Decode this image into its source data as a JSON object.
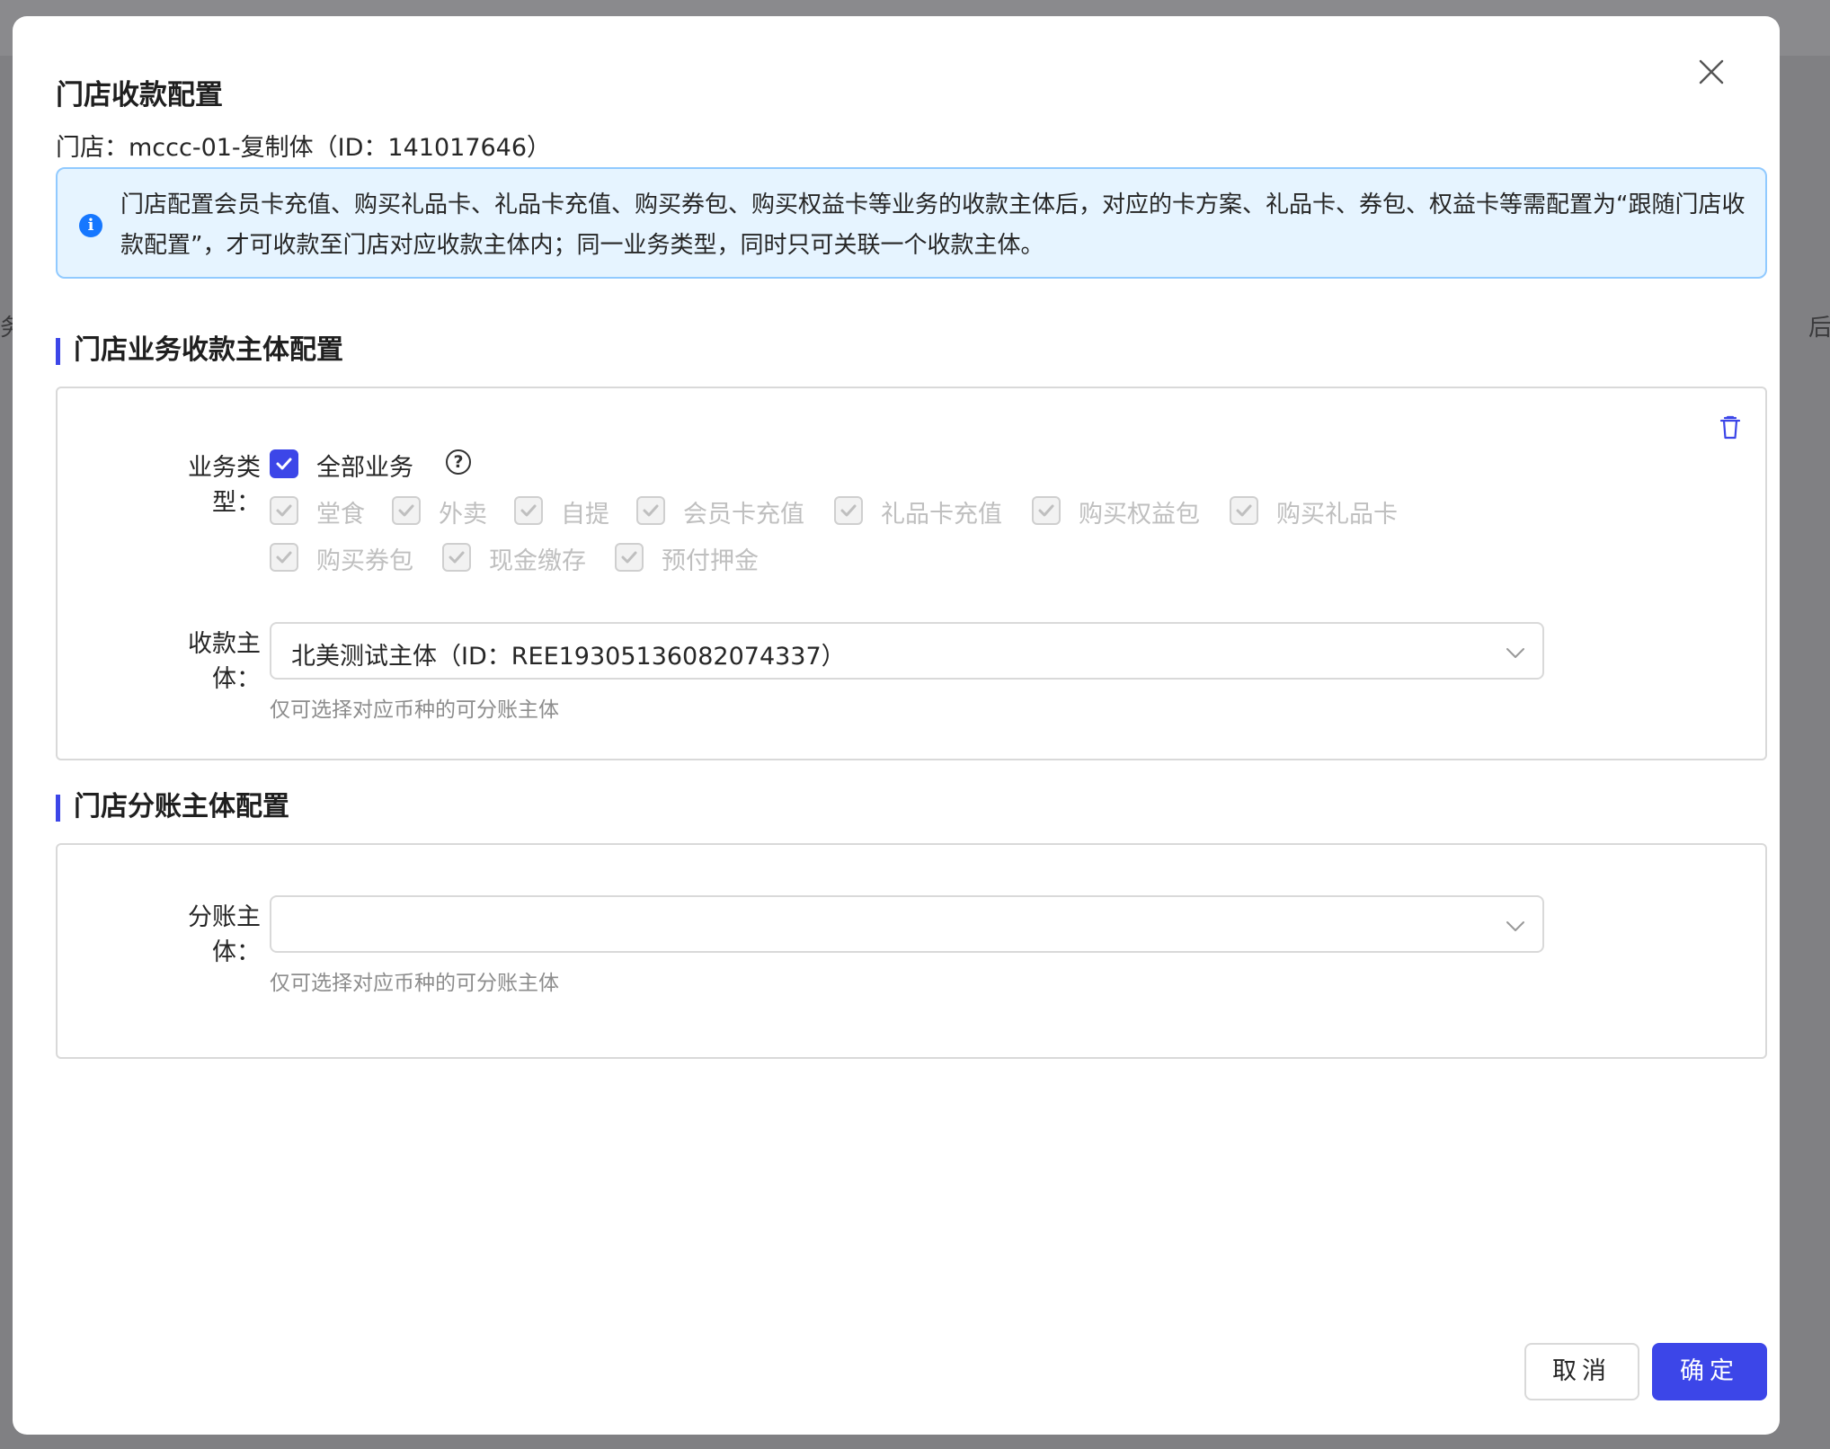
{
  "modal": {
    "title": "门店收款配置",
    "store_line": "门店：mccc-01-复制体（ID：141017646）"
  },
  "alert": {
    "text": "门店配置会员卡充值、购买礼品卡、礼品卡充值、购买券包、购买权益卡等业务的收款主体后，对应的卡方案、礼品卡、券包、权益卡等需配置为“跟随门店收款配置”，才可收款至门店对应收款主体内；同一业务类型，同时只可关联一个收款主体。"
  },
  "payment_section": {
    "title": "门店业务收款主体配置",
    "business_type_label": "业务类型：",
    "all_business": {
      "label": "全部业务",
      "checked": true
    },
    "business_options": [
      {
        "label": "堂食",
        "checked": true
      },
      {
        "label": "外卖",
        "checked": true
      },
      {
        "label": "自提",
        "checked": true
      },
      {
        "label": "会员卡充值",
        "checked": true
      },
      {
        "label": "礼品卡充值",
        "checked": true
      },
      {
        "label": "购买权益包",
        "checked": true
      },
      {
        "label": "购买礼品卡",
        "checked": true
      },
      {
        "label": "购买券包",
        "checked": true
      },
      {
        "label": "现金缴存",
        "checked": true
      },
      {
        "label": "预付押金",
        "checked": true
      }
    ],
    "entity_label": "收款主体：",
    "entity_value": "北美测试主体（ID：REE19305136082074337）",
    "entity_hint": "仅可选择对应币种的可分账主体"
  },
  "split_section": {
    "title": "门店分账主体配置",
    "entity_label": "分账主体：",
    "entity_value": "",
    "entity_hint": "仅可选择对应币种的可分账主体"
  },
  "footer": {
    "cancel_label": "取消",
    "ok_label": "确定"
  },
  "colors": {
    "primary": "#3c46e8",
    "info_bg": "#e6f4ff",
    "info_border": "#91caff",
    "info_icon": "#1677ff"
  },
  "icons": {
    "close": "close-icon",
    "info": "info-icon",
    "help": "question-circle-icon",
    "delete": "trash-icon",
    "dropdown": "chevron-down-icon",
    "check": "check-icon"
  }
}
